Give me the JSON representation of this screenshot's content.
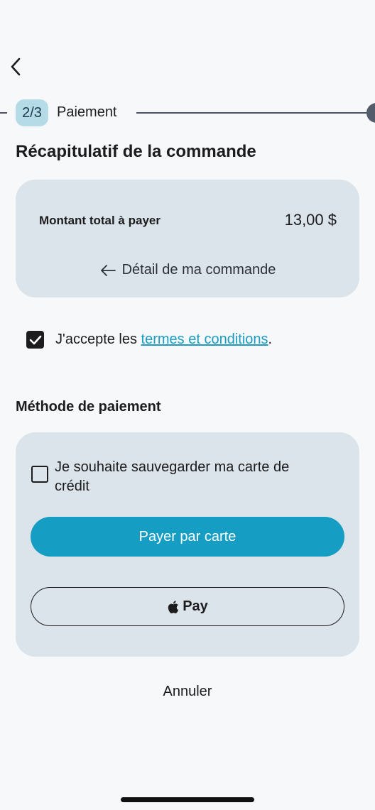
{
  "header": {
    "back_icon": "chevron-left-icon"
  },
  "stepper": {
    "step": "2/3",
    "label": "Paiement"
  },
  "summary": {
    "title": "Récapitulatif de la commande",
    "total_label": "Montant total à payer",
    "total_value": "13,00 $",
    "detail_link": "Détail de ma commande"
  },
  "terms": {
    "checked": true,
    "prefix": "J'accepte les ",
    "link": "termes et conditions",
    "suffix": "."
  },
  "payment": {
    "title": "Méthode de paiement",
    "save_card_checked": false,
    "save_card_label": "Je souhaite sauvegarder ma carte de crédit",
    "pay_card_label": "Payer par carte",
    "apple_pay_label": "Pay"
  },
  "actions": {
    "cancel_label": "Annuler"
  },
  "colors": {
    "accent": "#169dc3",
    "link": "#1a9cc2",
    "card_bg": "#dbe4ea",
    "step_badge_bg": "#b5dbe6"
  }
}
